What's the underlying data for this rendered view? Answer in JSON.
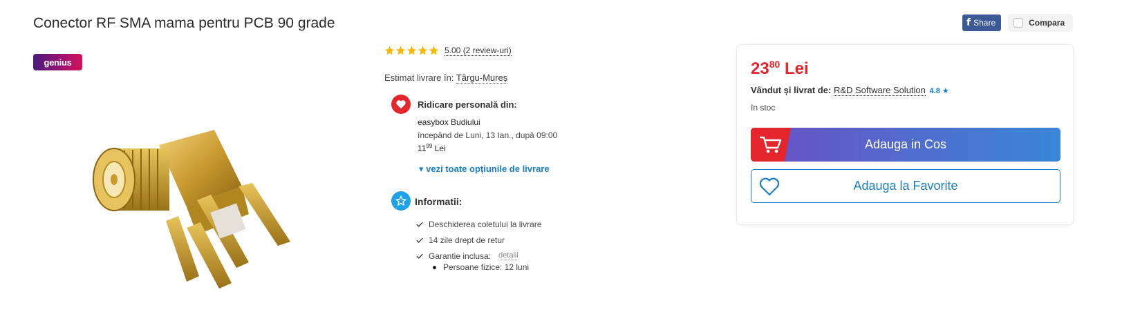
{
  "product": {
    "title": "Conector RF SMA mama pentru PCB 90 grade",
    "badge": "genius",
    "image_alt": "SMA female right-angle PCB connector, gold plated"
  },
  "actions": {
    "share_label": "Share",
    "share_icon": "facebook-icon",
    "compare_label": "Compara"
  },
  "rating": {
    "stars": 5,
    "text": "5.00 (2 review-uri)",
    "star_color": "#f5b800"
  },
  "delivery": {
    "estimate_label": "Estimat livrare în:",
    "city": "Târgu-Mureș"
  },
  "pickup": {
    "title": "Ridicare personală din:",
    "location": "easybox Budiului",
    "when": "începând de Luni, 13 Ian., după 09:00",
    "price_int": "11",
    "price_dec": "99",
    "currency": "Lei",
    "all_options": "vezi toate opțiunile de livrare",
    "icon_color": "#e4252b"
  },
  "info": {
    "title": "Informatii:",
    "items": [
      "Deschiderea coletului la livrare",
      "14 zile drept de retur",
      "Garantie inclusa:"
    ],
    "details_link": "detalii",
    "sub_item": "Persoane fizice: 12 luni",
    "icon_color": "#1ea1e6"
  },
  "buy_box": {
    "price_int": "23",
    "price_dec": "80",
    "currency": "Lei",
    "price_color": "#e4252b",
    "seller_label": "Vândut și livrat de:",
    "seller_name": "R&D Software Solution",
    "seller_rating": "4.8",
    "stock": "în stoc",
    "add_to_cart": "Adauga in Cos",
    "add_to_favorites": "Adauga la Favorite",
    "accent_color": "#1a7cc6"
  }
}
